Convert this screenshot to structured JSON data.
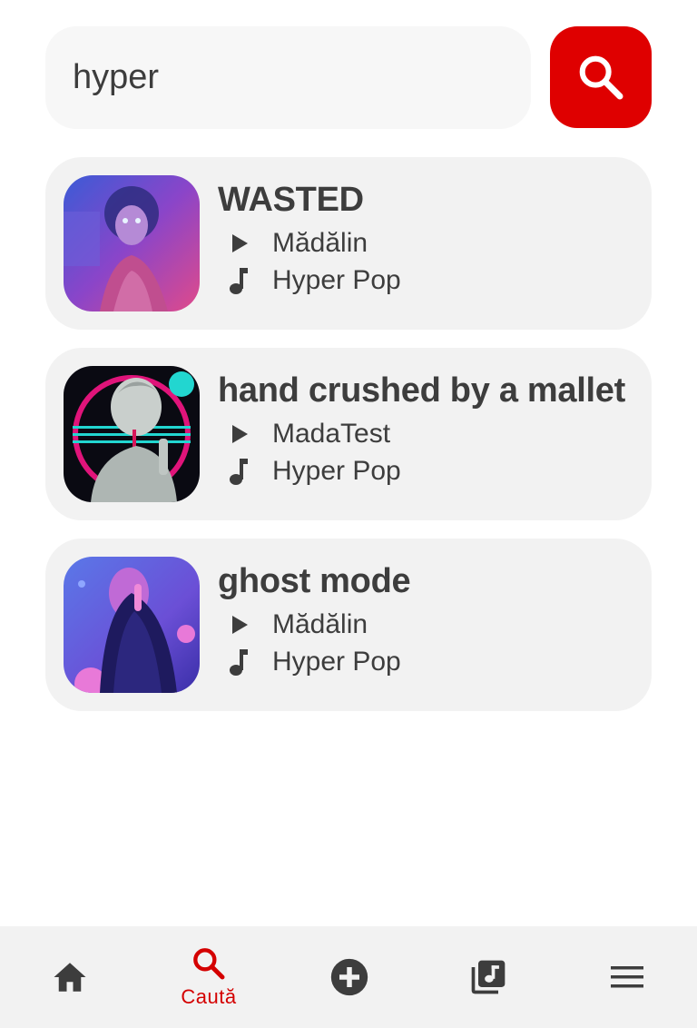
{
  "search": {
    "value": "hyper",
    "placeholder": "",
    "button_icon": "search-icon"
  },
  "colors": {
    "accent": "#df0000",
    "card_bg": "#f2f2f2",
    "text": "#3d3d3d",
    "nav_active": "#d40000"
  },
  "results": [
    {
      "title": "WASTED",
      "artist": "Mădălin",
      "genre": "Hyper Pop",
      "artist_icon": "play-icon",
      "genre_icon": "music-note-icon"
    },
    {
      "title": "hand crushed by a mallet",
      "artist": "MadaTest",
      "genre": "Hyper Pop",
      "artist_icon": "play-icon",
      "genre_icon": "music-note-icon"
    },
    {
      "title": "ghost mode",
      "artist": "Mădălin",
      "genre": "Hyper Pop",
      "artist_icon": "play-icon",
      "genre_icon": "music-note-icon"
    }
  ],
  "nav": {
    "items": [
      {
        "icon": "home-icon",
        "label": ""
      },
      {
        "icon": "search-icon",
        "label": "Caută",
        "active": true
      },
      {
        "icon": "add-circle-icon",
        "label": ""
      },
      {
        "icon": "library-music-icon",
        "label": ""
      },
      {
        "icon": "menu-icon",
        "label": ""
      }
    ]
  }
}
